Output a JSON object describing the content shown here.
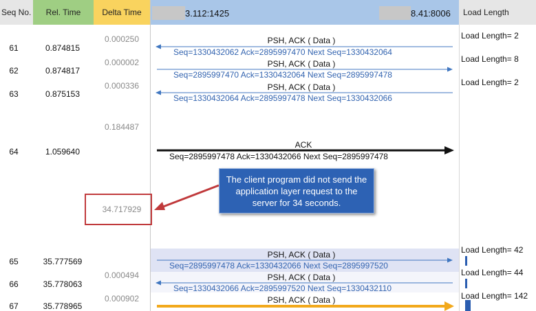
{
  "header": {
    "seq_no": "Seq No.",
    "rel_time": "Rel. Time",
    "delta_time": "Delta Time",
    "left_ip_suffix": "3.112:1425",
    "right_ip_suffix": "8.41:8006",
    "load_length": "Load Length"
  },
  "colors": {
    "seq_header": "#e6e6e6",
    "rel_header": "#9fce83",
    "delta_header": "#f9d35e",
    "flow_header": "#a9c6e8",
    "arrow_blue": "#3f76c0",
    "arrow_orange": "#f2a91c",
    "callout_bg": "#2d62b4",
    "red_pointer": "#c0393b"
  },
  "rows": [
    {
      "seq": "61",
      "rel": "0.874815",
      "delta": "0.000250",
      "flag": "PSH, ACK ( Data )",
      "detail": "Seq=1330432062  Ack=2895997470  Next Seq=1330432064",
      "load": "Load Length=  2"
    },
    {
      "seq": "62",
      "rel": "0.874817",
      "delta": "0.000002",
      "flag": "PSH, ACK ( Data )",
      "detail": "Seq=2895997470  Ack=1330432064  Next Seq=2895997478",
      "load": "Load Length=  8"
    },
    {
      "seq": "63",
      "rel": "0.875153",
      "delta": "0.000336",
      "flag": "PSH, ACK ( Data )",
      "detail": "Seq=1330432064  Ack=2895997478  Next Seq=1330432066",
      "load": "Load Length=  2"
    },
    {
      "seq": "64",
      "rel": "1.059640",
      "delta": "0.184487",
      "flag": "ACK",
      "detail": "Seq=2895997478  Ack=1330432066  Next Seq=2895997478",
      "load": ""
    },
    {
      "seq": "",
      "rel": "",
      "delta": "34.717929",
      "flag": "",
      "detail": "",
      "load": ""
    },
    {
      "seq": "65",
      "rel": "35.777569",
      "delta": "",
      "flag": "PSH, ACK ( Data )",
      "detail": "Seq=2895997478  Ack=1330432066  Next Seq=2895997520",
      "load": "Load Length=  42"
    },
    {
      "seq": "66",
      "rel": "35.778063",
      "delta": "0.000494",
      "flag": "PSH, ACK ( Data )",
      "detail": "Seq=1330432066  Ack=2895997520  Next Seq=1330432110",
      "load": "Load Length=  44"
    },
    {
      "seq": "67",
      "rel": "35.778965",
      "delta": "0.000902",
      "flag": "PSH, ACK ( Data )",
      "detail": "",
      "load": "Load Length=  142"
    }
  ],
  "callout": {
    "text": "The client program did not send the application layer request to the server for 34 seconds."
  },
  "icons": {
    "left_arrow": "arrow-left-icon",
    "right_arrow": "arrow-right-icon"
  }
}
